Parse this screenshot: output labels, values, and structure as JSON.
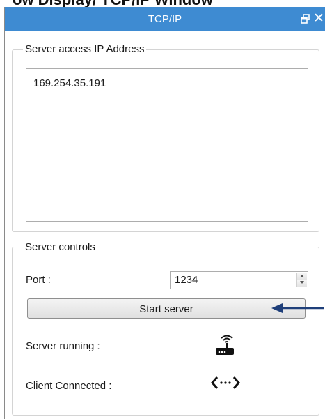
{
  "top_cut_text": "ow Display/ TCP/IP Window",
  "window": {
    "title": "TCP/IP",
    "restore_icon": "restore-window-icon",
    "close_glyph": "✕"
  },
  "ip_group": {
    "legend": "Server access IP Address",
    "addresses": [
      "169.254.35.191"
    ]
  },
  "controls_group": {
    "legend": "Server controls",
    "port_label": "Port :",
    "port_value": "1234",
    "start_button_label": "Start server",
    "server_running_label": "Server running :",
    "client_connected_label": "Client Connected :",
    "server_running_icon": "wireless-router-icon",
    "client_connected_icon": "connection-icon"
  },
  "colors": {
    "titlebar": "#3e8bd2",
    "annotation_arrow": "#1f3f7a"
  }
}
